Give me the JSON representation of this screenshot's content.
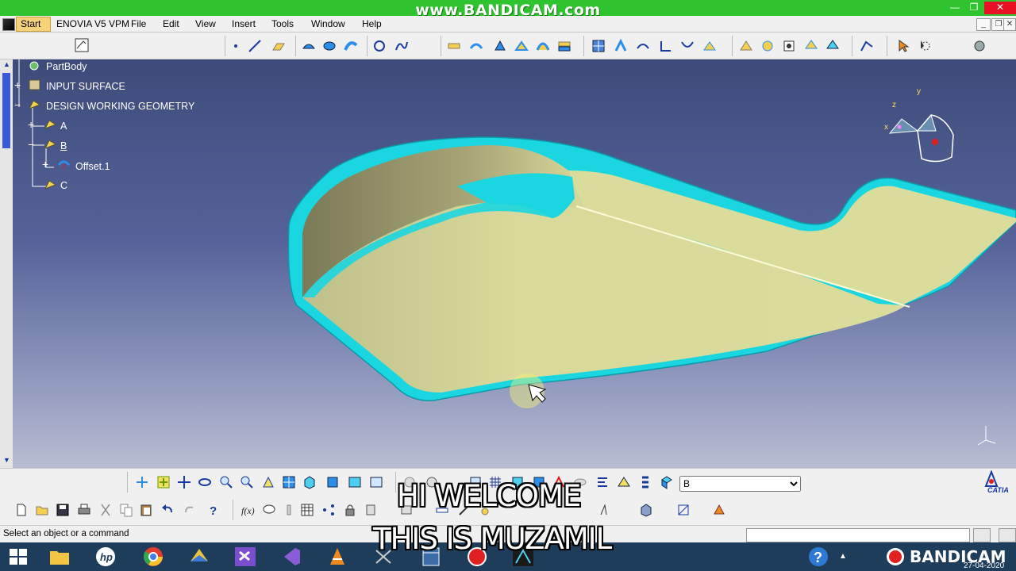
{
  "watermark_top": "www.BANDICAM.com",
  "menu": {
    "start": "Start",
    "workbench": "ENOVIA V5 VPM",
    "items": [
      "File",
      "Edit",
      "View",
      "Insert",
      "Tools",
      "Window",
      "Help"
    ]
  },
  "tree": {
    "items": [
      {
        "label": "PartBody",
        "icon": "gear-body-icon"
      },
      {
        "label": "INPUT SURFACE",
        "icon": "geometrical-set-icon"
      },
      {
        "label": "DESIGN WORKING GEOMETRY",
        "icon": "geometrical-set-icon"
      },
      {
        "label": "A",
        "icon": "geometrical-set-icon"
      },
      {
        "label": "B",
        "icon": "geometrical-set-icon"
      },
      {
        "label": "Offset.1",
        "icon": "offset-surface-icon"
      },
      {
        "label": "C",
        "icon": "geometrical-set-icon"
      }
    ]
  },
  "compass_labels": {
    "y": "y",
    "z": "z",
    "x": "x"
  },
  "current_set_select": {
    "value": "B"
  },
  "brand": "CATIA",
  "status_text": "Select an object or a command",
  "subtitles": {
    "line1": "HI WELCOME",
    "line2": "THIS IS MUZAMIL"
  },
  "taskbar": {
    "watermark": "BANDICAM",
    "date": "27-04-2020",
    "icons": [
      "windows-start-icon",
      "file-explorer-icon",
      "hp-icon",
      "chrome-icon",
      "app-icon",
      "visual-studio-icon",
      "visual-studio-alt-icon",
      "vlc-icon",
      "snipping-icon",
      "calculator-icon",
      "record-icon",
      "catia-icon",
      "help-icon"
    ]
  },
  "colors": {
    "titlebar": "#2fc42f",
    "part_face": "#d8d99a",
    "part_edge": "#19d6e0",
    "viewport_top": "#3d4b7a"
  }
}
